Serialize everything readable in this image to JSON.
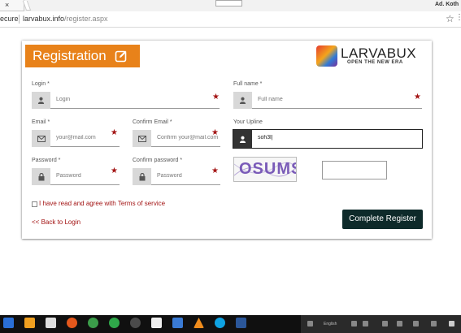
{
  "browser": {
    "tab_close": "×",
    "secure": "ecure",
    "url_domain": "larvabux.info",
    "url_path": "/register.aspx",
    "user_label": "Ad. Koth",
    "star": "☆",
    "menu": "⋮"
  },
  "header": {
    "title": "Registration",
    "logo_name_a": "LARVA",
    "logo_name_b": "BUX",
    "logo_tagline": "OPEN THE NEW ERA"
  },
  "form": {
    "login": {
      "label": "Login",
      "req": " *",
      "placeholder": "Login"
    },
    "fullname": {
      "label": "Full name",
      "req": " *",
      "placeholder": "Full name"
    },
    "email": {
      "label": "Email",
      "req": " *",
      "placeholder": "your@mail.com"
    },
    "confirm_email": {
      "label": "Confirm Email",
      "req": " *",
      "placeholder": "Confirm your@mail.com"
    },
    "upline": {
      "label": "Your Upline",
      "value": "soh3l|"
    },
    "password": {
      "label": "Password",
      "req": " *",
      "placeholder": "Password"
    },
    "confirm_password": {
      "label": "Confirm password",
      "req": " *",
      "placeholder": "Password"
    },
    "captcha_text": "OSUMS",
    "captcha_value": "",
    "agree_text": "I have read and agree with ",
    "agree_link": "Terms of service",
    "back_link": "<< Back to Login",
    "submit_label": "Complete Register",
    "required_star": "★"
  },
  "taskbar": {
    "language": "English"
  }
}
